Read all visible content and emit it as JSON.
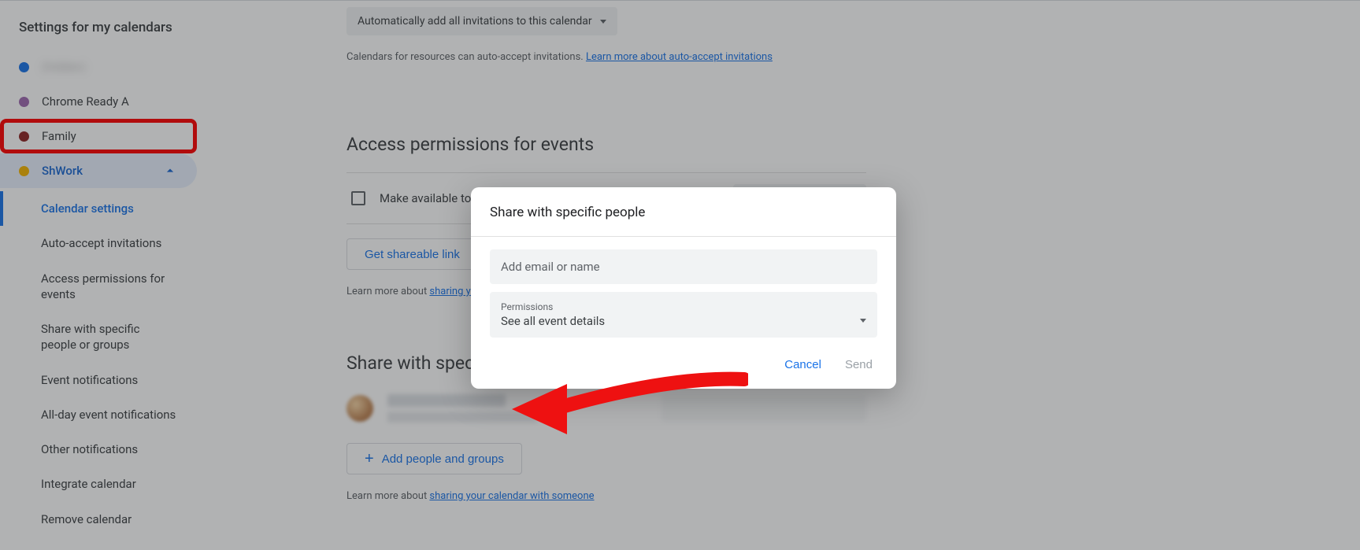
{
  "sidebar": {
    "heading": "Settings for my calendars",
    "calendars": [
      {
        "label": "(hidden)",
        "color": "#1a73e8",
        "blurred": true
      },
      {
        "label": "Chrome Ready A",
        "color": "#9e69af",
        "blurred": false
      },
      {
        "label": "Family",
        "color": "#8e2424",
        "blurred": false,
        "highlight": true
      },
      {
        "label": "ShWork",
        "color": "#f4b400",
        "blurred": false,
        "active": true
      }
    ],
    "subnav": [
      {
        "label": "Calendar settings",
        "active": true
      },
      {
        "label": "Auto-accept invitations"
      },
      {
        "label": "Access permissions for events"
      },
      {
        "label": "Share with specific people or groups"
      },
      {
        "label": "Event notifications"
      },
      {
        "label": "All-day event notifications"
      },
      {
        "label": "Other notifications"
      },
      {
        "label": "Integrate calendar"
      },
      {
        "label": "Remove calendar"
      }
    ]
  },
  "main": {
    "auto_accept_select": "Automatically add all invitations to this calendar",
    "auto_accept_help_pre": "Calendars for resources can auto-accept invitations. ",
    "auto_accept_help_link": "Learn more about auto-accept invitations",
    "access_heading": "Access permissions for events",
    "make_public_label": "Make available to public",
    "see_all_label": "See all event details",
    "share_link_btn": "Get shareable link",
    "share_help_pre": "Learn more about ",
    "share_help_link": "sharing your calendar",
    "share_section_head": "Share with specific people or groups",
    "add_people_btn": "Add people and groups",
    "share_help2_pre": "Learn more about ",
    "share_help2_link": "sharing your calendar with someone"
  },
  "dialog": {
    "title": "Share with specific people",
    "email_placeholder": "Add email or name",
    "perm_label": "Permissions",
    "perm_value": "See all event details",
    "cancel": "Cancel",
    "send": "Send"
  }
}
